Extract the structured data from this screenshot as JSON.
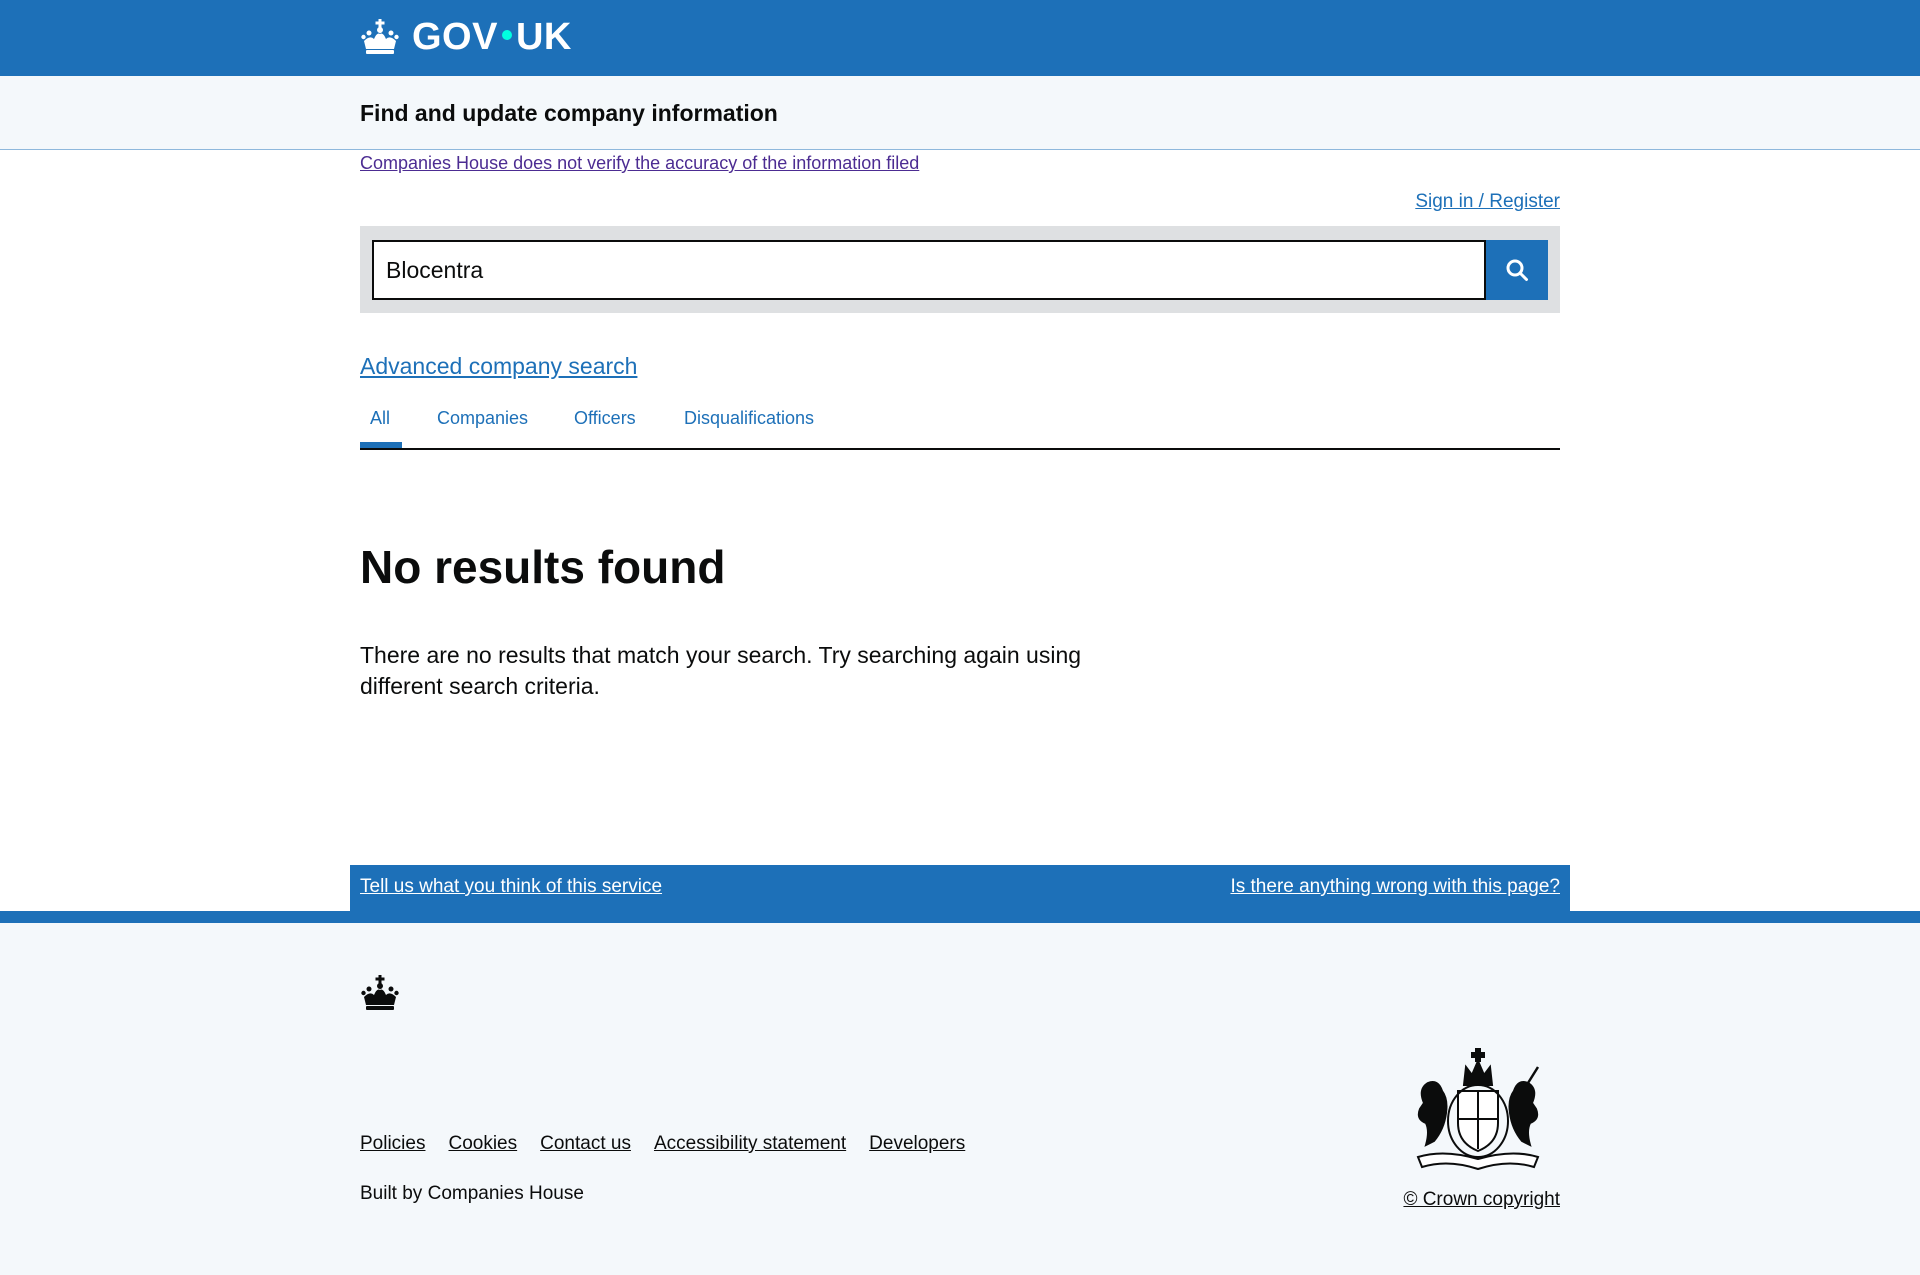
{
  "header": {
    "logo_text_left": "GOV",
    "logo_text_right": "UK",
    "logo_icon": "crown-icon",
    "brand_color": "#1d70b8",
    "dot_color": "#00ffe0"
  },
  "service": {
    "name": "Find and update company information"
  },
  "notice": {
    "disclaimer": "Companies House does not verify the accuracy of the information filed",
    "signin": "Sign in / Register"
  },
  "search": {
    "value": "Blocentra",
    "button_icon": "search-icon"
  },
  "advanced_link": "Advanced company search",
  "tabs": [
    {
      "label": "All",
      "active": true
    },
    {
      "label": "Companies",
      "active": false
    },
    {
      "label": "Officers",
      "active": false
    },
    {
      "label": "Disqualifications",
      "active": false
    }
  ],
  "results": {
    "title": "No results found",
    "message": "There are no results that match your search. Try searching again using different search criteria."
  },
  "feedback": {
    "left": "Tell us what you think of this service",
    "right": "Is there anything wrong with this page?"
  },
  "footer": {
    "links": [
      "Policies",
      "Cookies",
      "Contact us",
      "Accessibility statement",
      "Developers"
    ],
    "built_by_prefix": "Built by ",
    "built_by_link": "Companies House",
    "copyright": "© Crown copyright",
    "crest_icon": "royal-coat-of-arms-icon"
  }
}
